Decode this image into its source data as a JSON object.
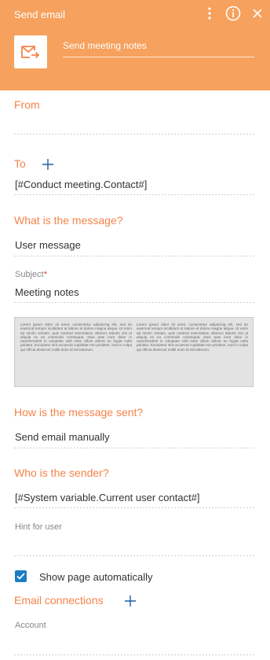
{
  "header": {
    "title": "Send email",
    "element_name": "Send meeting notes",
    "bg_color": "#f6a15d"
  },
  "from": {
    "label": "From",
    "value": ""
  },
  "to": {
    "label": "To",
    "value": "[#Conduct meeting.Contact#]"
  },
  "message": {
    "label": "What is the message?",
    "type_value": "User message",
    "subject_label": "Subject",
    "subject_required_mark": "*",
    "subject_value": "Meeting notes",
    "preview_col1": "Lorem ipsum dolor sit amet, consectetur adipiscing elit, sed do eiusmod tempor incididunt ut labore et dolore magna aliqua. Ut enim ad minim veniam, quis nostrud exercitation ullamco laboris nisi ut aliquip ex ea commodo consequat. Duis aute irure dolor in reprehenderit in voluptate velit esse cillum dolore eu fugiat nulla pariatur. Excepteur sint occaecat cupidatat non proident, sunt in culpa qui officia deserunt mollit anim id est laborum.",
    "preview_col2": "Lorem ipsum dolor sit amet, consectetur adipiscing elit, sed do eiusmod tempor incididunt ut labore et dolore magna aliqua. Ut enim ad minim veniam, quis nostrud exercitation ullamco laboris nisi ut aliquip ex ea commodo consequat. Duis aute irure dolor in reprehenderit in voluptate velit esse cillum dolore eu fugiat nulla pariatur. Excepteur sint occaecat cupidatat non proident, sunt in culpa qui officia deserunt mollit anim id est laborum."
  },
  "sending": {
    "label": "How is the message sent?",
    "value": "Send email manually"
  },
  "sender": {
    "label": "Who is the sender?",
    "value": "[#System variable.Current user contact#]"
  },
  "hint": {
    "label": "Hint for user",
    "value": ""
  },
  "show_page": {
    "label": "Show page automatically",
    "checked": true
  },
  "connections": {
    "label": "Email connections"
  },
  "account": {
    "label": "Account",
    "value": ""
  },
  "colors": {
    "accent": "#f4834a",
    "checkbox": "#1b7ec2",
    "plus": "#1b5fa8"
  },
  "icons": [
    "menu-dots-icon",
    "info-icon",
    "close-icon",
    "email-tile-icon",
    "add-icon",
    "checkmark-icon"
  ]
}
